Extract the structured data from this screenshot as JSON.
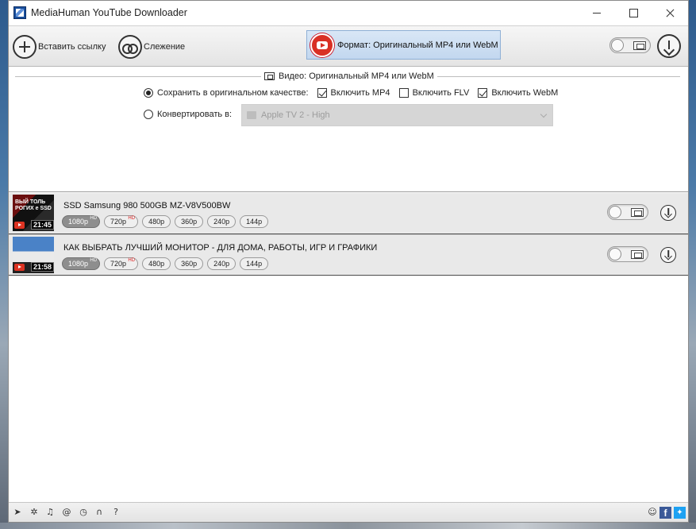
{
  "window": {
    "title": "MediaHuman YouTube Downloader"
  },
  "toolbar": {
    "paste_link_label": "Вставить ссылку",
    "tracking_label": "Слежение",
    "format_label": "Формат: Оригинальный MP4 или WebM"
  },
  "settings": {
    "section_title": "Видео: Оригинальный MP4 или WebM",
    "save_original_label": "Сохранить в оригинальном качестве:",
    "include_mp4_label": "Включить MP4",
    "include_flv_label": "Включить FLV",
    "include_webm_label": "Включить WebM",
    "convert_label": "Конвертировать в:",
    "convert_target": "Apple TV 2 - High",
    "save_original_selected": true,
    "include_mp4": true,
    "include_flv": false,
    "include_webm": true
  },
  "items": [
    {
      "title": "SSD Samsung 980 500GB MZ-V8V500BW",
      "duration": "21:45",
      "thumb_text": "ВЫЙ ТОЛЬ РОГИХ е SSD",
      "badges": [
        {
          "label": "1080p",
          "sup": "HD",
          "active": true
        },
        {
          "label": "720p",
          "sup": "HD",
          "active": false
        },
        {
          "label": "480p",
          "sup": "",
          "active": false
        },
        {
          "label": "360p",
          "sup": "",
          "active": false
        },
        {
          "label": "240p",
          "sup": "",
          "active": false
        },
        {
          "label": "144p",
          "sup": "",
          "active": false
        }
      ]
    },
    {
      "title": "КАК ВЫБРАТЬ ЛУЧШИЙ МОНИТОР - ДЛЯ ДОМА, РАБОТЫ, ИГР И ГРАФИКИ",
      "duration": "21:58",
      "thumb_text": "",
      "badges": [
        {
          "label": "1080p",
          "sup": "HD",
          "active": true
        },
        {
          "label": "720p",
          "sup": "HD",
          "active": false
        },
        {
          "label": "480p",
          "sup": "",
          "active": false
        },
        {
          "label": "360p",
          "sup": "",
          "active": false
        },
        {
          "label": "240p",
          "sup": "",
          "active": false
        },
        {
          "label": "144p",
          "sup": "",
          "active": false
        }
      ]
    }
  ],
  "statusbar": {
    "icons": [
      "send-icon",
      "settings-gear-icon",
      "music-icon",
      "snail-icon",
      "clock-icon",
      "binoculars-icon",
      "help-icon"
    ],
    "glyphs": [
      "➤",
      "✲",
      "♫",
      "@",
      "◷",
      "∩",
      "?"
    ],
    "right_icons": [
      "support-agent-icon",
      "facebook-icon",
      "twitter-icon"
    ]
  },
  "colors": {
    "accent_format_bg": "#c2d7ef",
    "youtube_red": "#d93025",
    "badge_active": "#8e8e8e"
  }
}
